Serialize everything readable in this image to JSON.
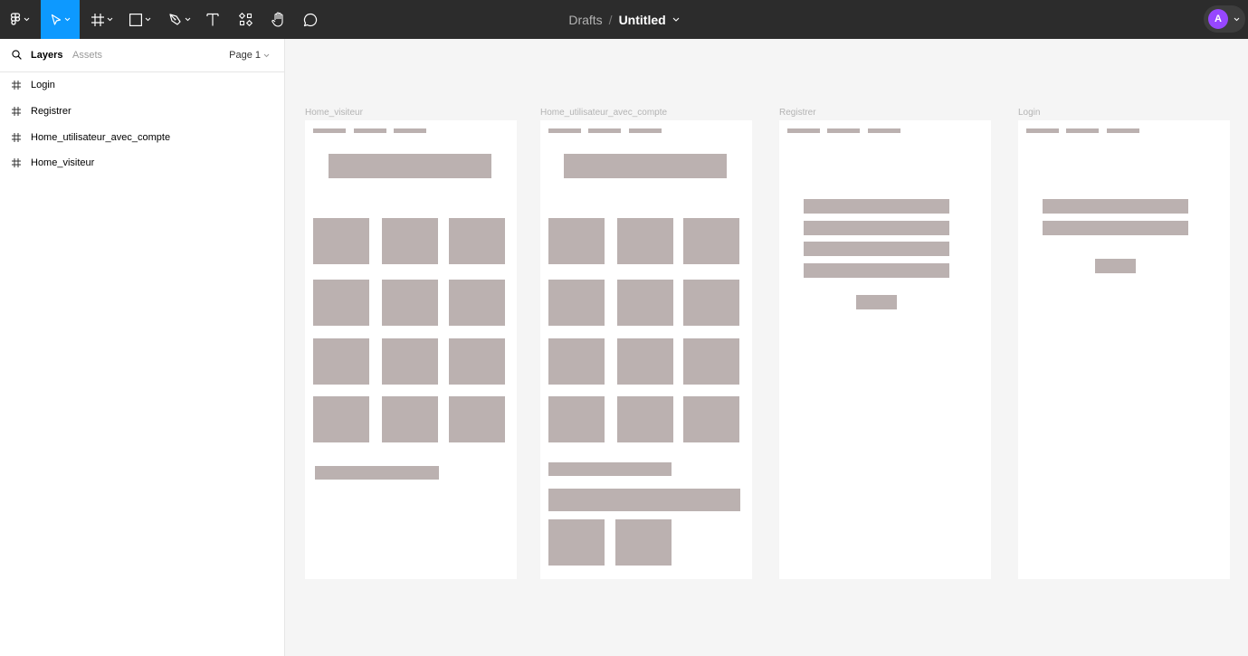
{
  "toolbar": {
    "tools": [
      {
        "name": "main-menu",
        "icon": "figma-logo-icon"
      },
      {
        "name": "move-tool",
        "icon": "cursor-arrow-icon",
        "active": true
      },
      {
        "name": "frame-tool",
        "icon": "frame-hash-icon"
      },
      {
        "name": "shape-tool",
        "icon": "rectangle-icon"
      },
      {
        "name": "pen-tool",
        "icon": "pen-icon"
      },
      {
        "name": "text-tool",
        "icon": "text-T-icon"
      },
      {
        "name": "resources-tool",
        "icon": "components-icon"
      },
      {
        "name": "hand-tool",
        "icon": "hand-icon"
      },
      {
        "name": "comment-tool",
        "icon": "comment-bubble-icon"
      }
    ],
    "breadcrumb": {
      "location": "Drafts",
      "separator": "/",
      "file_title": "Untitled"
    },
    "user": {
      "initial": "A",
      "color": "#9747ff"
    },
    "active_color": "#0d99ff",
    "background": "#2c2c2c"
  },
  "left_panel": {
    "tabs": {
      "layers": "Layers",
      "assets": "Assets"
    },
    "page": "Page 1",
    "layers": [
      "Login",
      "Registrer",
      "Home_utilisateur_avec_compte",
      "Home_visiteur"
    ]
  },
  "canvas": {
    "background": "#f5f5f5",
    "placeholder_color": "#bbb1b0",
    "frames": [
      {
        "name": "Home_visiteur"
      },
      {
        "name": "Home_utilisateur_avec_compte"
      },
      {
        "name": "Registrer"
      },
      {
        "name": "Login"
      }
    ]
  }
}
